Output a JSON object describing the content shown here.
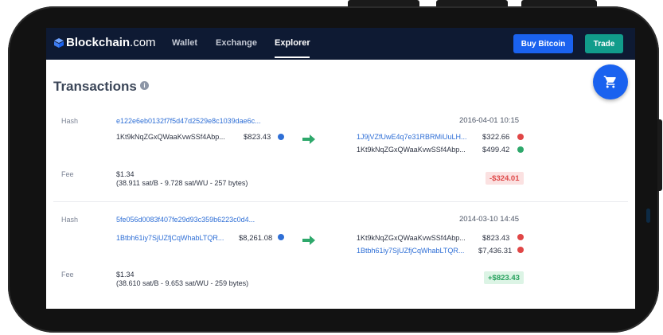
{
  "navbar": {
    "logo_main": "Blockchain",
    "logo_suffix": ".com",
    "links": [
      "Wallet",
      "Exchange",
      "Explorer"
    ],
    "buy_label": "Buy Bitcoin",
    "trade_label": "Trade"
  },
  "page": {
    "title": "Transactions",
    "info_icon": "info-icon",
    "cart_icon": "cart-icon"
  },
  "transactions": [
    {
      "hash_label": "Hash",
      "hash": "e122e6eb0132f7f5d47d2529e8c1039dae6c...",
      "timestamp": "2016-04-01 10:15",
      "input": {
        "address": "1Kt9kNqZGxQWaaKvwSSf4Abp...",
        "amount": "$823.43"
      },
      "outputs": [
        {
          "address": "1J9jVZfUwE4q7e31RBRMiUuLH...",
          "amount": "$322.66",
          "status": "spent"
        },
        {
          "address": "1Kt9kNqZGxQWaaKvwSSf4Abp...",
          "amount": "$499.42",
          "status": "unspent"
        }
      ],
      "fee_label": "Fee",
      "fee": "$1.34",
      "fee_detail": "(38.911 sat/B - 9.728 sat/WU - 257 bytes)",
      "net": "-$324.01"
    },
    {
      "hash_label": "Hash",
      "hash": "5fe056d0083f407fe29d93c359b6223c0d4...",
      "timestamp": "2014-03-10 14:45",
      "input": {
        "address": "1Btbh61iy7SjUZfjCqWhabLTQR...",
        "amount": "$8,261.08"
      },
      "outputs": [
        {
          "address": "1Kt9kNqZGxQWaaKvwSSf4Abp...",
          "amount": "$823.43",
          "status": "spent"
        },
        {
          "address": "1Btbh61iy7SjUZfjCqWhabLTQR...",
          "amount": "$7,436.31",
          "status": "spent"
        }
      ],
      "fee_label": "Fee",
      "fee": "$1.34",
      "fee_detail": "(38.610 sat/B - 9.653 sat/WU - 259 bytes)",
      "net": "+$823.43"
    }
  ],
  "colors": {
    "nav_bg": "#0e1a33",
    "buy_button": "#1a62ef",
    "trade_button": "#119c8b",
    "link": "#2f6fd6",
    "negative": "#de4a4a",
    "positive": "#25a05c"
  }
}
